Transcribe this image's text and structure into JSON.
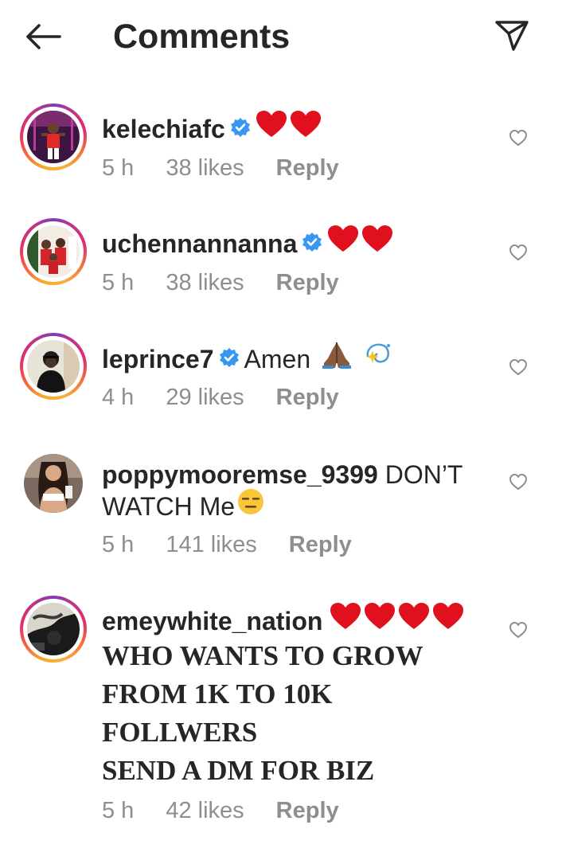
{
  "header": {
    "title": "Comments"
  },
  "comments": [
    {
      "username": "kelechiafc",
      "verified": true,
      "text": "",
      "emoji": "two-red-hearts",
      "time": "5 h",
      "likes": "38 likes",
      "reply": "Reply"
    },
    {
      "username": "uchennannanna",
      "verified": true,
      "text": "",
      "emoji": "two-red-hearts",
      "time": "5 h",
      "likes": "38 likes",
      "reply": "Reply"
    },
    {
      "username": "leprince7",
      "verified": true,
      "text": "Amen",
      "emoji": "folded-hands-dizzy",
      "time": "4 h",
      "likes": "29 likes",
      "reply": "Reply"
    },
    {
      "username": "poppymooremse_9399",
      "verified": false,
      "text": "DON’T",
      "text2": "WATCH Me",
      "emoji": "expressionless-face",
      "time": "5 h",
      "likes": "141 likes",
      "reply": "Reply"
    },
    {
      "username": "emeywhite_nation",
      "verified": false,
      "text": "",
      "emoji": "four-red-hearts",
      "body_lines": [
        "WHO WANTS TO GROW",
        "FROM 1K TO 10K",
        "FOLLWERS",
        "SEND A DM FOR BIZ"
      ],
      "time": "5 h",
      "likes": "42 likes",
      "reply": "Reply"
    }
  ],
  "colors": {
    "verified": "#3897f0",
    "heart": "#e0101e",
    "meta": "#8e8e8e",
    "text": "#262626"
  }
}
